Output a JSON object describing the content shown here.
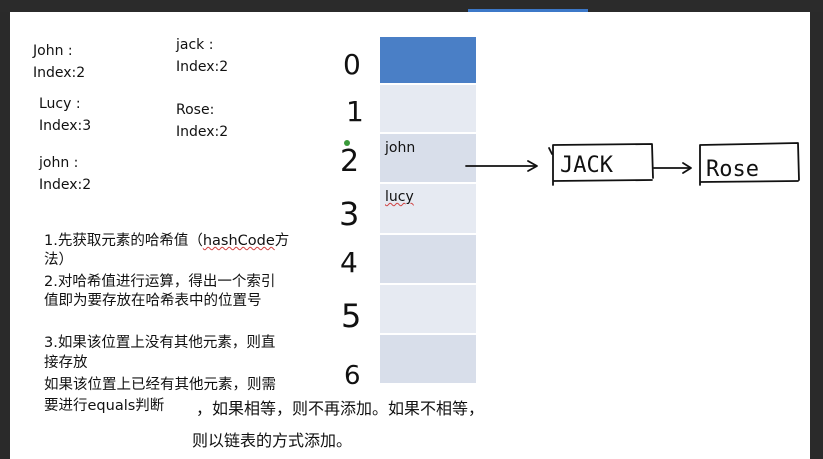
{
  "entries": [
    {
      "name": "John :",
      "index": "Index:2"
    },
    {
      "name": "jack :",
      "index": "Index:2"
    },
    {
      "name": "Lucy :",
      "index": "Index:3"
    },
    {
      "name": "Rose:",
      "index": "Index:2"
    },
    {
      "name": "john :",
      "index": "Index:2"
    }
  ],
  "steps": {
    "s1_line1": "1.先获取元素的哈希值（",
    "s1_code": "hashCode",
    "s1_after": "方",
    "s1_line2": "法）",
    "s2_line1": "2.对哈希值进行运算，得出一个索引",
    "s2_line2": "值即为要存放在哈希表中的位置号",
    "s3_line1": "3.如果该位置上没有其他元素，则直",
    "s3_line2": "接存放",
    "s3_line3": "如果该位置上已经有其他元素，则需",
    "s3_line4": "要进行equals判断",
    "s3_line5": "，如果相等，则不再添加。如果不相等，",
    "s3_line6": "则以链表的方式添加。"
  },
  "table": {
    "indices": [
      "0",
      "1",
      "2",
      "3",
      "4",
      "5",
      "6"
    ],
    "cells": [
      "",
      "",
      "john",
      "lucy",
      "",
      "",
      ""
    ]
  },
  "chain": [
    "JACK",
    "Rose"
  ],
  "colors": {
    "cell_first": "#4a7fc6",
    "cell_fill": "#d8deea",
    "cell_alt": "#e6eaf2"
  }
}
